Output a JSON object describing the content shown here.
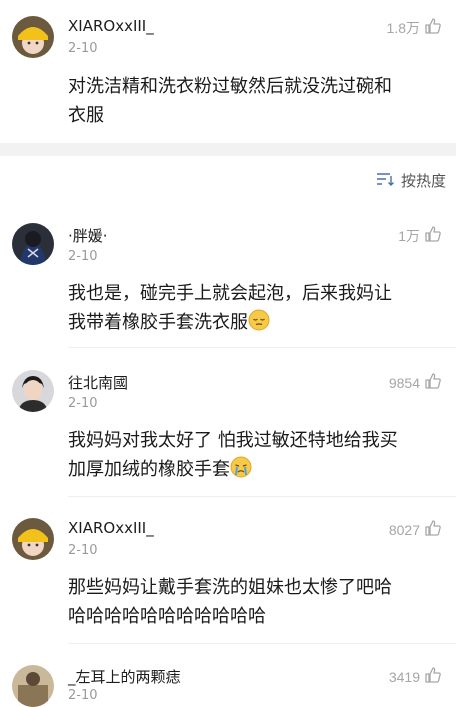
{
  "top_comment": {
    "username": "XIAROxxIII_",
    "date": "2-10",
    "likes": "1.8万",
    "text_line1": "对洗洁精和洗衣粉过敏然后就没洗过碗和",
    "text_line2": "衣服"
  },
  "sort": {
    "label": "按热度"
  },
  "replies": [
    {
      "username": "·胖媛·",
      "date": "2-10",
      "likes": "1万",
      "text_line1": "我也是，碰完手上就会起泡，后来我妈让",
      "text_line2": "我带着橡胶手套洗衣服"
    },
    {
      "username": "往北南國",
      "date": "2-10",
      "likes": "9854",
      "text_line1": "我妈妈对我太好了 怕我过敏还特地给我买",
      "text_line2": "加厚加绒的橡胶手套"
    },
    {
      "username": "XIAROxxIII_",
      "date": "2-10",
      "likes": "8027",
      "text_line1": "那些妈妈让戴手套洗的姐妹也太惨了吧哈",
      "text_line2": "哈哈哈哈哈哈哈哈哈哈哈"
    },
    {
      "username": "_左耳上的两颗痣",
      "date": "2-10",
      "likes": "3419"
    }
  ],
  "colors": {
    "accent_icon": "#4a6fa5",
    "like_gray": "#a6a6a6"
  }
}
